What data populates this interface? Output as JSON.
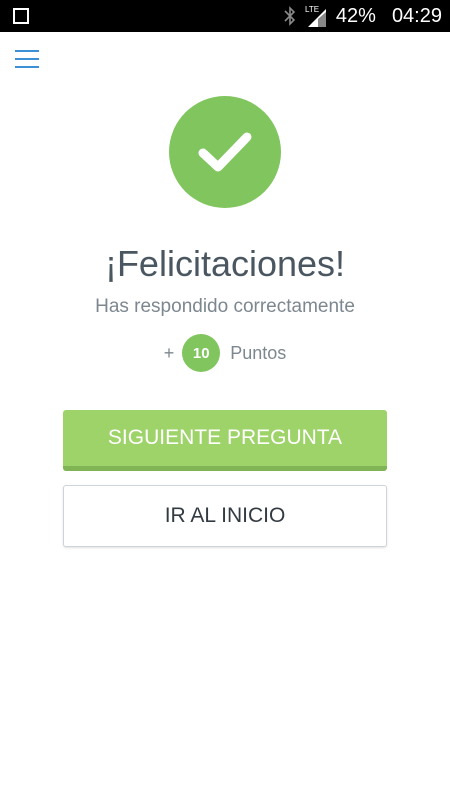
{
  "status_bar": {
    "battery": "42%",
    "time": "04:29",
    "network": "LTE",
    "icons": [
      "square-notification-icon",
      "bluetooth-icon",
      "signal-icon"
    ]
  },
  "header": {
    "menu_icon": "hamburger-menu-icon"
  },
  "result": {
    "icon": "checkmark-icon",
    "title": "¡Felicitaciones!",
    "subtitle": "Has respondido correctamente",
    "points_prefix": "+",
    "points_value": "10",
    "points_label": "Puntos"
  },
  "actions": {
    "next_label": "SIGUIENTE PREGUNTA",
    "home_label": "IR AL INICIO"
  },
  "colors": {
    "accent_green": "#80c55e",
    "button_green": "#9ed36a",
    "menu_blue": "#3d8fd6",
    "title_text": "#4a5660",
    "muted_text": "#7d8790"
  }
}
